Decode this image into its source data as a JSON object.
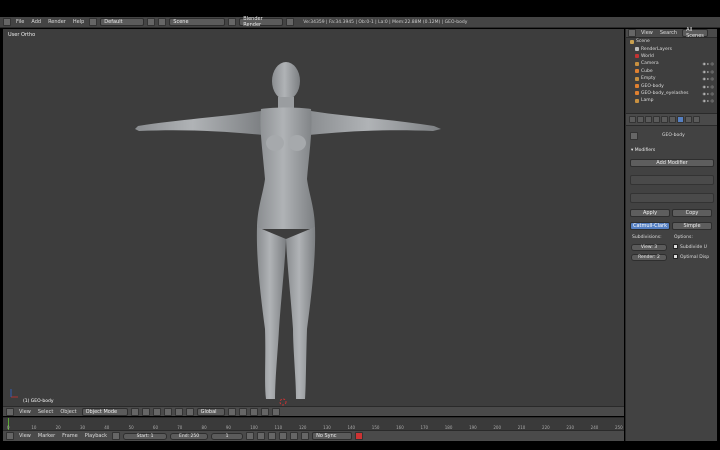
{
  "menu": {
    "items": [
      "File",
      "Add",
      "Render",
      "Help"
    ],
    "screen_layout": "Default",
    "scene": "Scene",
    "render_engine": "Blender Render",
    "info": "Ve:34359 | Fa:34.3945 | Ob:0-1 | La:0 | Mem:22.88M (0.12M) | GEO-body"
  },
  "viewport": {
    "title": "User Ortho",
    "object_label": "(1) GEO-body"
  },
  "viewport_header": {
    "view": "View",
    "select": "Select",
    "object": "Object",
    "mode": "Object Mode",
    "orientation": "Global"
  },
  "timeline": {
    "ticks": [
      "0",
      "10",
      "20",
      "30",
      "40",
      "50",
      "60",
      "70",
      "80",
      "90",
      "100",
      "110",
      "120",
      "130",
      "140",
      "150",
      "160",
      "170",
      "180",
      "190",
      "200",
      "210",
      "220",
      "230",
      "240",
      "250"
    ],
    "header": {
      "view": "View",
      "marker": "Marker",
      "frame": "Frame",
      "playback": "Playback",
      "start": "Start: 1",
      "end": "End: 250",
      "current": "1",
      "sync": "No Sync"
    }
  },
  "outliner": {
    "header": {
      "view": "View",
      "search": "Search",
      "scope": "All Scenes"
    },
    "items": [
      {
        "label": "Scene",
        "color": "#c8a050",
        "indent": 0
      },
      {
        "label": "RenderLayers",
        "color": "#bbbbbb",
        "indent": 1
      },
      {
        "label": "World",
        "color": "#c33333",
        "indent": 1
      },
      {
        "label": "Camera",
        "color": "#c89040",
        "indent": 1
      },
      {
        "label": "Cube",
        "color": "#e08030",
        "indent": 1
      },
      {
        "label": "Empty",
        "color": "#c89040",
        "indent": 1
      },
      {
        "label": "GEO-body",
        "color": "#e08030",
        "indent": 1
      },
      {
        "label": "GEO-body_eyelashes",
        "color": "#e08030",
        "indent": 1
      },
      {
        "label": "Lamp",
        "color": "#c89040",
        "indent": 1
      }
    ]
  },
  "properties": {
    "object_name": "GEO-body",
    "section": "Modifiers",
    "add_modifier": "Add Modifier",
    "apply": "Apply",
    "copy": "Copy",
    "catmull": "Catmull-Clark",
    "simple": "Simple",
    "subdivisions_label": "Subdivisions:",
    "options_label": "Options:",
    "view_field": "View: 3",
    "render_field": "Render: 2",
    "subdivide_uvs": "Subdivide U",
    "optimal_display": "Optimal Disp"
  },
  "colors": {
    "viewport_bg": "#3d3d3d",
    "mesh": "#a0a3a6",
    "accent_blue": "#5680c2"
  }
}
